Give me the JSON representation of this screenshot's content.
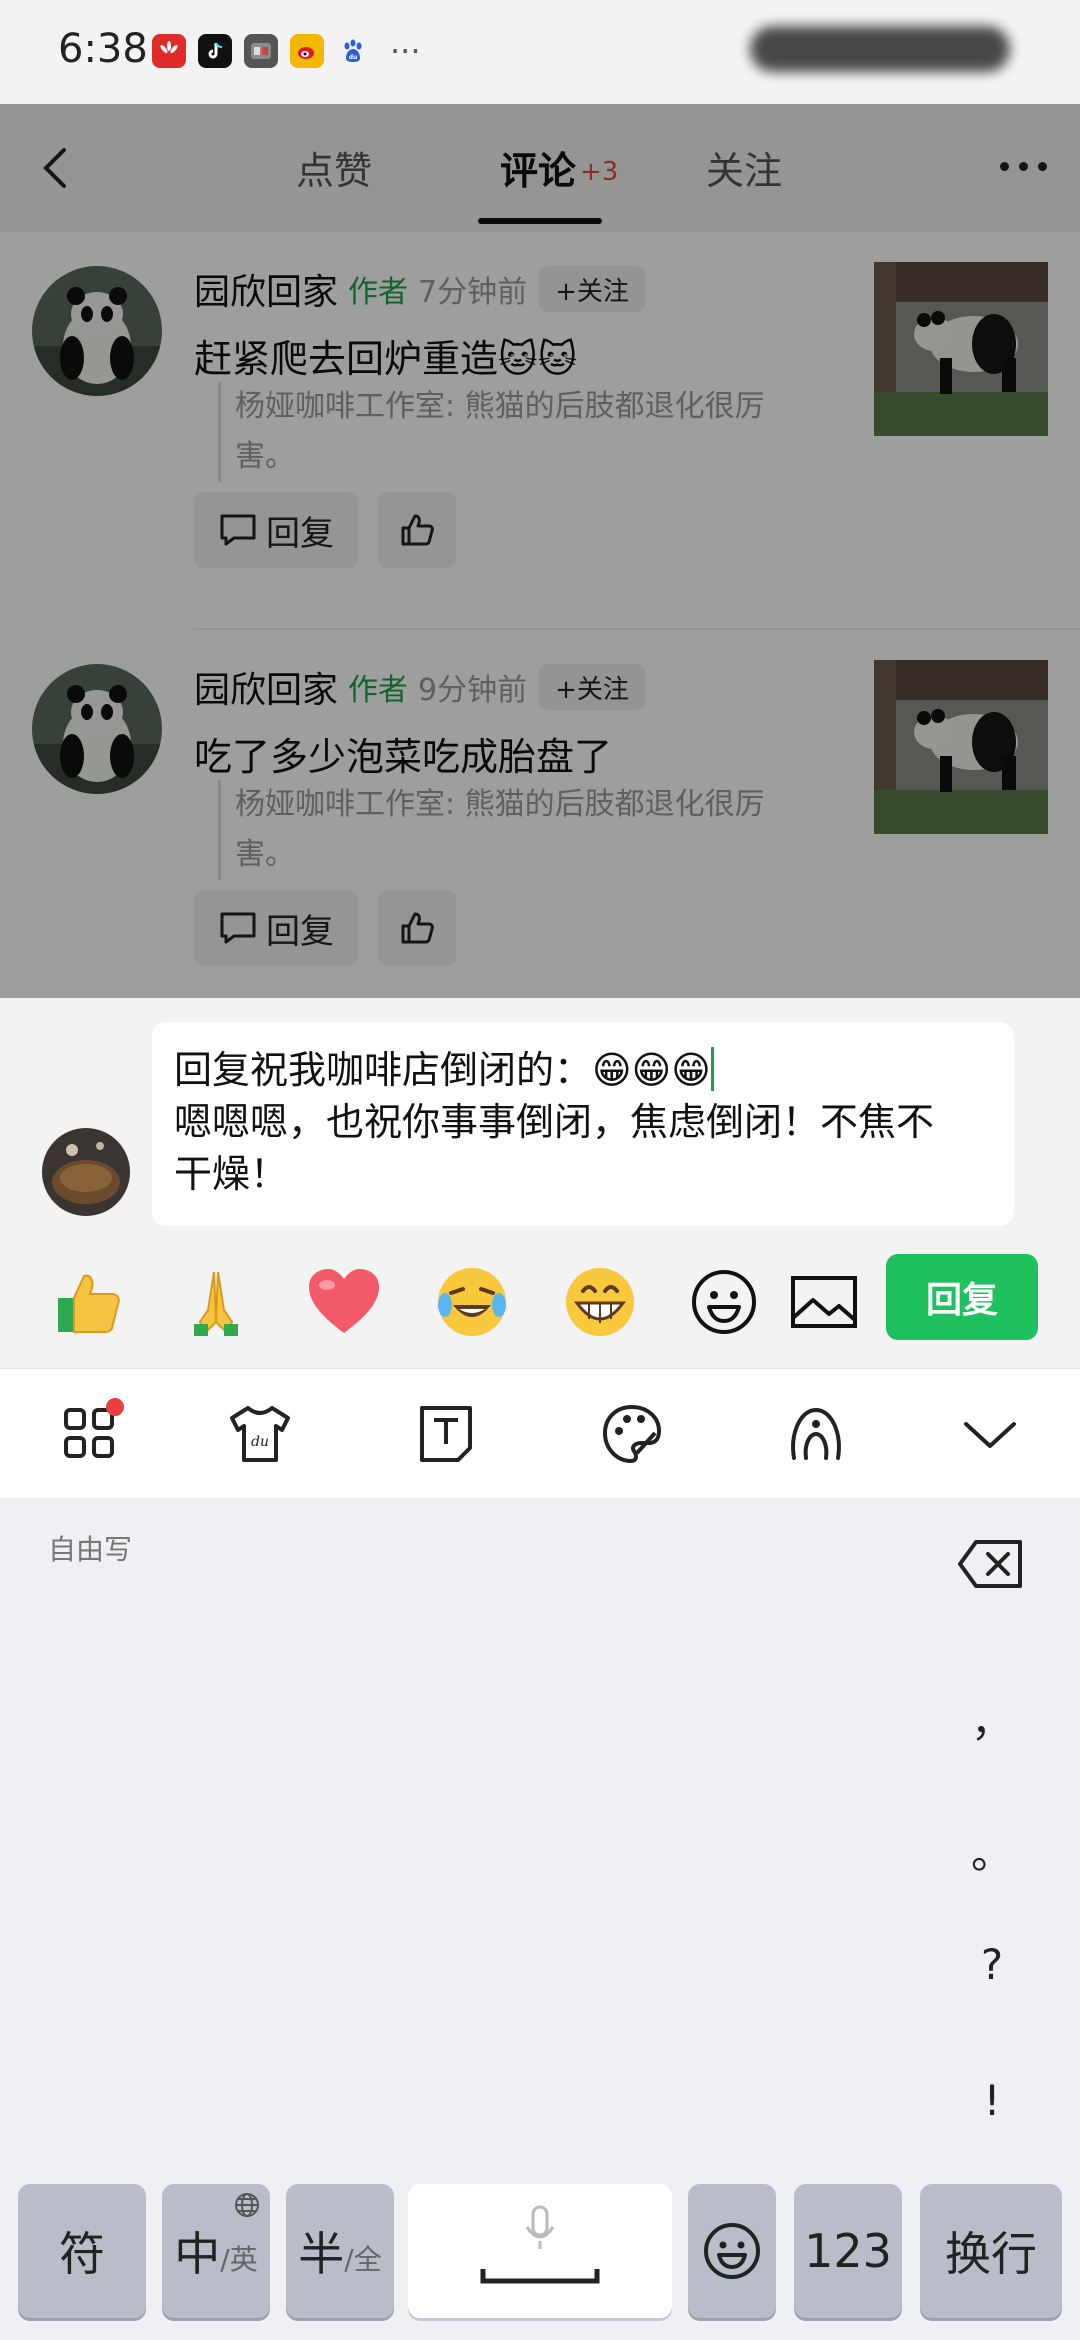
{
  "status_bar": {
    "time": "6:38",
    "apps": [
      {
        "icon": "huawei-icon",
        "color": "#e02b2b"
      },
      {
        "icon": "tiktok-icon",
        "color": "#111111"
      },
      {
        "icon": "game-icon",
        "color": "#555555"
      },
      {
        "icon": "weibo-icon",
        "color": "#f5b800"
      },
      {
        "icon": "baidu-icon",
        "color": "#f3f3f3"
      }
    ],
    "more": "···"
  },
  "nav": {
    "tabs": [
      {
        "label": "点赞",
        "badge": ""
      },
      {
        "label": "评论",
        "badge": "+3"
      },
      {
        "label": "关注",
        "badge": ""
      }
    ],
    "active_tab": "评论"
  },
  "comments": [
    {
      "name": "园欣回家",
      "role": "作者",
      "time": "7分钟前",
      "follow_label": "+关注",
      "text": "赶紧爬去回炉重造🐱🐱",
      "quote_line1": "杨娅咖啡工作室: 熊猫的后肢都退化很厉",
      "quote_line2": "害。",
      "reply_label": "回复"
    },
    {
      "name": "园欣回家",
      "role": "作者",
      "time": "9分钟前",
      "follow_label": "+关注",
      "text": "吃了多少泡菜吃成胎盘了",
      "quote_line1": "杨娅咖啡工作室: 熊猫的后肢都退化很厉",
      "quote_line2": "害。",
      "reply_label": "回复"
    }
  ],
  "reply_box": {
    "line1": "回复祝我咖啡店倒闭的：",
    "line1_emojis": "😁😁😁",
    "line2": "嗯嗯嗯，也祝你事事倒闭，焦虑倒闭！不焦不",
    "line3": "干燥！"
  },
  "quick_emojis": [
    "👍",
    "🙏",
    "❤️",
    "😂",
    "😁"
  ],
  "submit_label": "回复",
  "keyboard": {
    "mode_label": "自由写",
    "punctuation": [
      "，",
      "。",
      "?",
      "!"
    ],
    "keys": {
      "symbol": "符",
      "lang_main": "中",
      "lang_alt": "/英",
      "width_main": "半",
      "width_alt": "/全",
      "number": "123",
      "enter": "换行"
    }
  },
  "colors": {
    "accent_green": "#1fc05e",
    "author_green": "#1ea04a",
    "badge_red": "#e54848"
  }
}
